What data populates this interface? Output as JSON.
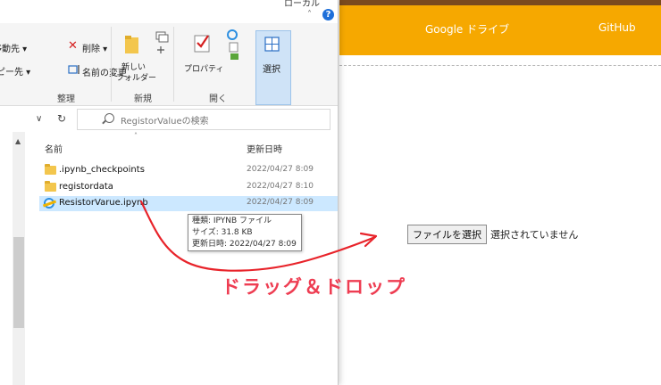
{
  "window": {
    "title_fragment": "ローカル"
  },
  "ribbon": {
    "move_to": "移動先 ▾",
    "copy_to": "コピー先 ▾",
    "delete": "削除 ▾",
    "rename": "名前の変更",
    "new_folder_l1": "新しい",
    "new_folder_l2": "フォルダー",
    "properties": "プロパティ",
    "select": "選択",
    "group_organize": "整理",
    "group_new": "新規",
    "group_open": "開く"
  },
  "search": {
    "placeholder": "RegistorValueの検索"
  },
  "columns": {
    "name": "名前",
    "modified": "更新日時"
  },
  "files": [
    {
      "name": ".ipynb_checkpoints",
      "date": "2022/04/27 8:09",
      "icon": "folder-icon"
    },
    {
      "name": "registordata",
      "date": "2022/04/27 8:10",
      "icon": "folder-icon"
    },
    {
      "name": "ResistorVarue.ipynb",
      "date": "2022/04/27 8:09",
      "icon": "ie-file-icon"
    }
  ],
  "tooltip": {
    "type": "種類: IPYNB ファイル",
    "size": "サイズ: 31.8 KB",
    "modified": "更新日時: 2022/04/27 8:09"
  },
  "web": {
    "nav_drive": "Google ドライブ",
    "nav_github": "GitHub",
    "file_button": "ファイルを選択",
    "file_status": "選択されていません"
  },
  "annotation": {
    "caption": "ドラッグ＆ドロップ"
  },
  "colors": {
    "header": "#f6a800",
    "header_stripe": "#7a4a1e",
    "arrow": "#e8232a",
    "caption": "#ee3d52",
    "selection": "#cce8ff"
  }
}
